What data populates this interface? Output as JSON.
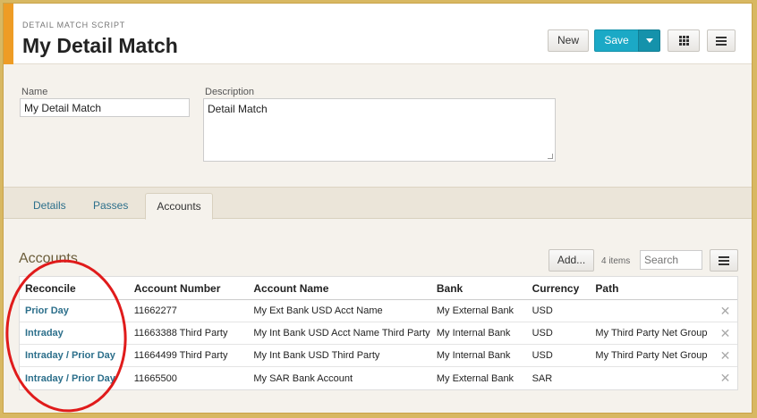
{
  "header": {
    "subtitle": "DETAIL MATCH SCRIPT",
    "title": "My Detail Match",
    "new_label": "New",
    "save_label": "Save"
  },
  "form": {
    "name_label": "Name",
    "name_value": "My Detail Match",
    "description_label": "Description",
    "description_value": "Detail Match"
  },
  "tabs": [
    {
      "label": "Details"
    },
    {
      "label": "Passes"
    },
    {
      "label": "Accounts",
      "active": true
    }
  ],
  "accounts": {
    "title": "Accounts",
    "add_label": "Add...",
    "item_count": "4 items",
    "search_placeholder": "Search",
    "columns": [
      "Reconcile",
      "Account Number",
      "Account Name",
      "Bank",
      "Currency",
      "Path"
    ],
    "rows": [
      {
        "reconcile": "Prior Day",
        "account_number": "11662277",
        "account_name": "My Ext Bank USD Acct Name",
        "bank": "My External Bank",
        "currency": "USD",
        "path": ""
      },
      {
        "reconcile": "Intraday",
        "account_number": "11663388 Third Party",
        "account_name": "My Int Bank USD Acct Name Third Party",
        "bank": "My Internal Bank",
        "currency": "USD",
        "path": "My Third Party Net Group"
      },
      {
        "reconcile": "Intraday / Prior Day",
        "account_number": "11664499 Third Party",
        "account_name": "My Int Bank USD Third Party",
        "bank": "My Internal Bank",
        "currency": "USD",
        "path": "My Third Party Net Group"
      },
      {
        "reconcile": "Intraday / Prior Day",
        "account_number": "11665500",
        "account_name": "My SAR Bank Account",
        "bank": "My External Bank",
        "currency": "SAR",
        "path": ""
      }
    ]
  },
  "colors": {
    "accent": "#ee9c25",
    "save_button": "#1ba9c6",
    "link": "#2c6f8b",
    "annotation": "#e01b1b"
  },
  "icons": {
    "grid": "grid-icon",
    "menu": "menu-icon",
    "caret": "caret-down-icon",
    "remove": "close-icon"
  }
}
